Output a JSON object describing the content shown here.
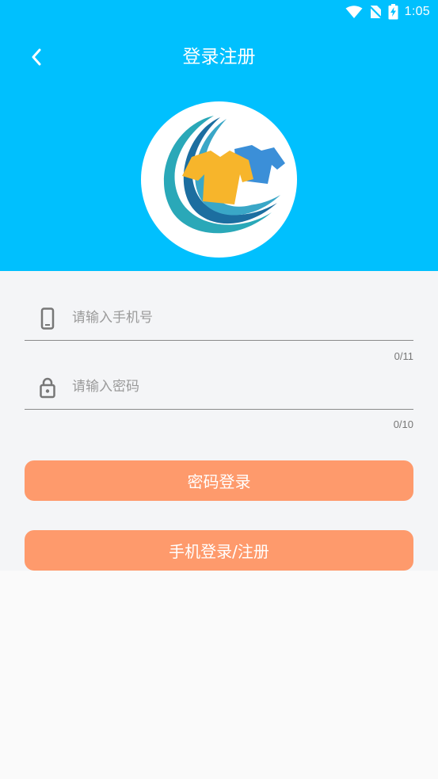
{
  "status_bar": {
    "time": "1:05",
    "icons": [
      "wifi-icon",
      "no-sim-icon",
      "battery-charging-icon"
    ]
  },
  "header": {
    "title": "登录注册",
    "back_icon": "chevron-left-icon",
    "background": "#00c0fe",
    "logo": "laundry-logo"
  },
  "form": {
    "phone": {
      "icon": "phone-icon",
      "placeholder": "请输入手机号",
      "value": "",
      "counter": "0/11"
    },
    "password": {
      "icon": "lock-icon",
      "placeholder": "请输入密码",
      "value": "",
      "counter": "0/10"
    }
  },
  "buttons": {
    "password_login": "密码登录",
    "phone_login_register": "手机登录/注册",
    "color": "#fe9a6c"
  }
}
